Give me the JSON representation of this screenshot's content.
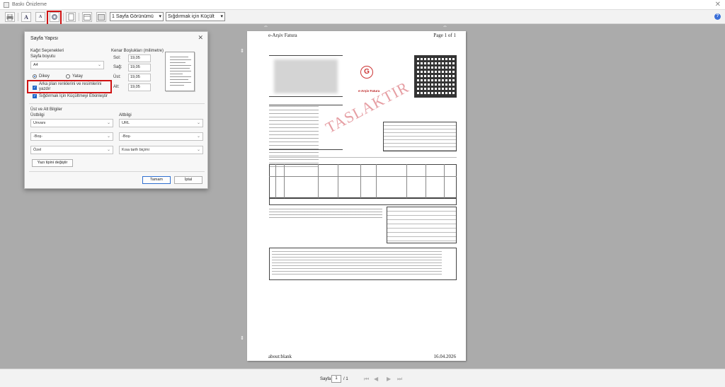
{
  "window": {
    "title": "Baskı Önizleme"
  },
  "toolbar": {
    "font_larger": "A",
    "font_smaller": "A",
    "view_mode": "1 Sayfa Görünümü",
    "zoom_mode": "Sığdırmak için Küçült"
  },
  "document": {
    "header_left": "e-Arşiv Fatura",
    "header_right": "Page 1 of 1",
    "footer_left": "about:blank",
    "footer_right": "16.04.2026",
    "logo_label": "e-Arşiv Fatura",
    "watermark": "TASLAKTIR"
  },
  "dialog": {
    "title": "Sayfa Yapısı",
    "paper_options_label": "Kağıt Seçenekleri",
    "paper_size_label": "Sayfa boyutu",
    "paper_size_value": "A4",
    "orientation_portrait": "Dikey",
    "orientation_landscape": "Yatay",
    "print_background_label": "Arka plan renklerini ve resimlerini yazdır",
    "shrink_to_fit_label": "Sığdırmak İçin Küçültmeyi Etkinleştir",
    "margins_label": "Kenar Boşlukları (milimetre)",
    "margin_left_label": "Sol:",
    "margin_left_value": "19,05",
    "margin_right_label": "Sağ:",
    "margin_right_value": "19,05",
    "margin_top_label": "Üst:",
    "margin_top_value": "19,05",
    "margin_bottom_label": "Alt:",
    "margin_bottom_value": "19,05",
    "header_footer_label": "Üst ve Alt Bilgiler",
    "header_label": "Üstbilgi",
    "footer_label": "Altbilgi",
    "header_1": "Unvanı",
    "footer_1": "URL",
    "header_2": "-Boş-",
    "footer_2": "-Boş-",
    "header_3": "Özel",
    "footer_3": "Kısa tarih biçimi",
    "change_font_button": "Yazı tipini değiştir",
    "ok_button": "Tamam",
    "cancel_button": "İptal"
  },
  "status": {
    "page_label": "Sayfa",
    "page_current": "1",
    "page_total": "/ 1"
  }
}
